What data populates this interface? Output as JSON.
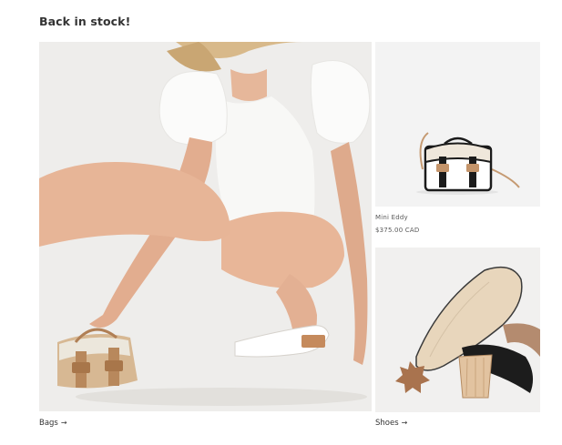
{
  "section": {
    "title": "Back in stock!"
  },
  "featured_product": {
    "name": "Mini Eddy",
    "price": "$375.00 CAD"
  },
  "collections": [
    {
      "label": "Bags",
      "arrow_icon": "arrow-right-icon"
    },
    {
      "label": "Shoes",
      "arrow_icon": "arrow-right-icon"
    }
  ],
  "colors": {
    "tile_background": "#efeeec",
    "text": "#333333",
    "accent_tan": "#c79a6a"
  }
}
